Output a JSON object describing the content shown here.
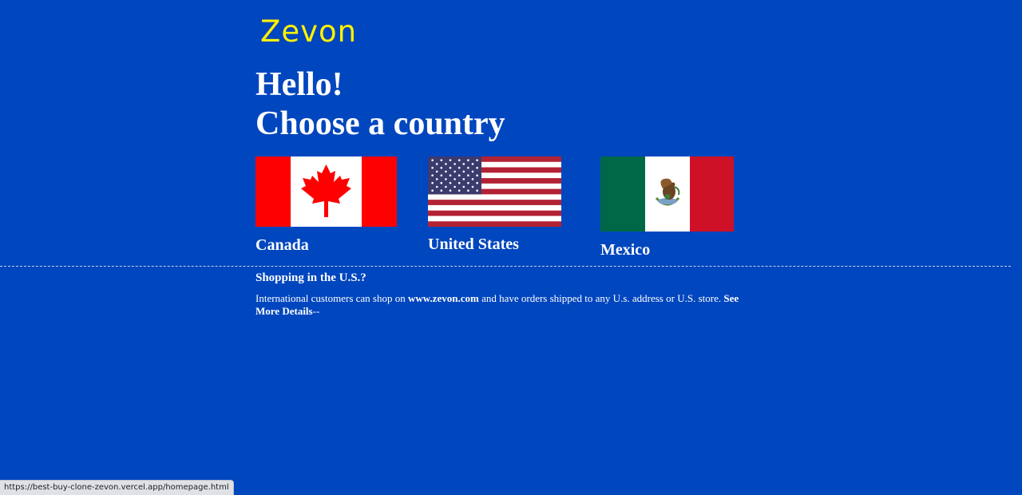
{
  "header": {
    "logo_text": "Zevon",
    "logo_color": "#fff200"
  },
  "greeting": {
    "line1": "Hello!",
    "line2": "Choose a country"
  },
  "countries": [
    {
      "name": "Canada",
      "flag": "canada-flag"
    },
    {
      "name": "United States",
      "flag": "us-flag"
    },
    {
      "name": "Mexico",
      "flag": "mexico-flag"
    }
  ],
  "shopping": {
    "title": "Shopping in the U.S.?",
    "text_prefix": "International customers can shop on ",
    "site": "www.zevon.com",
    "text_middle": " and have orders shipped to any U.s. address or U.S. store. ",
    "details_link": "See More Details",
    "details_suffix": "--"
  },
  "status_bar": {
    "url": "https://best-buy-clone-zevon.vercel.app/homepage.html"
  },
  "colors": {
    "background": "#0046be",
    "text": "#ffffff"
  }
}
